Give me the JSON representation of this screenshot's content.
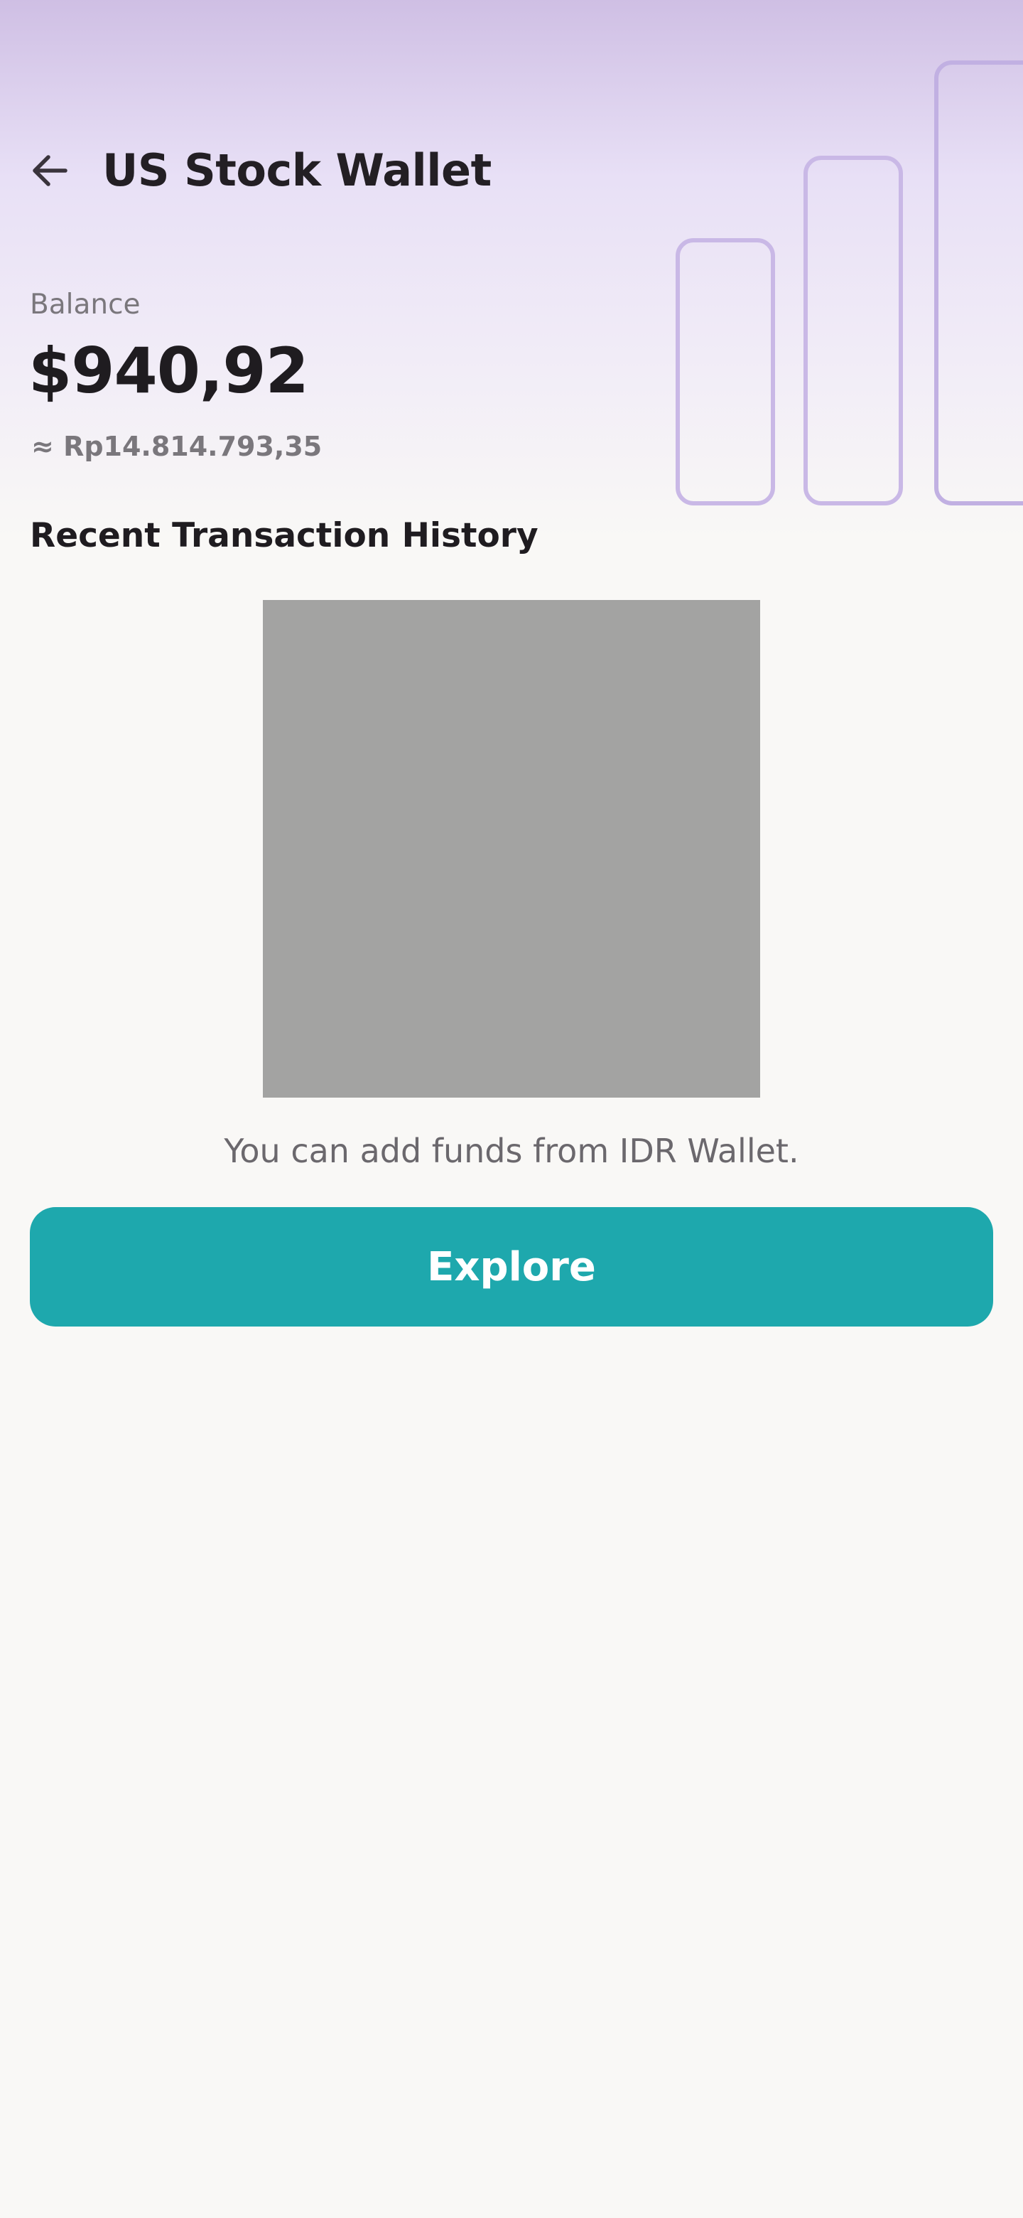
{
  "header": {
    "title": "US Stock Wallet",
    "back_icon": "arrow-left-icon"
  },
  "balance": {
    "label": "Balance",
    "amount": "$940,92",
    "idr_equivalent": "≈ Rp14.814.793,35"
  },
  "transactions": {
    "title": "Recent Transaction History",
    "empty_message": "You can add funds from IDR Wallet."
  },
  "actions": {
    "explore_label": "Explore"
  },
  "colors": {
    "accent": "#1ea8ad",
    "header_gradient_top": "#cfbfe4",
    "background": "#f9f8f6"
  }
}
